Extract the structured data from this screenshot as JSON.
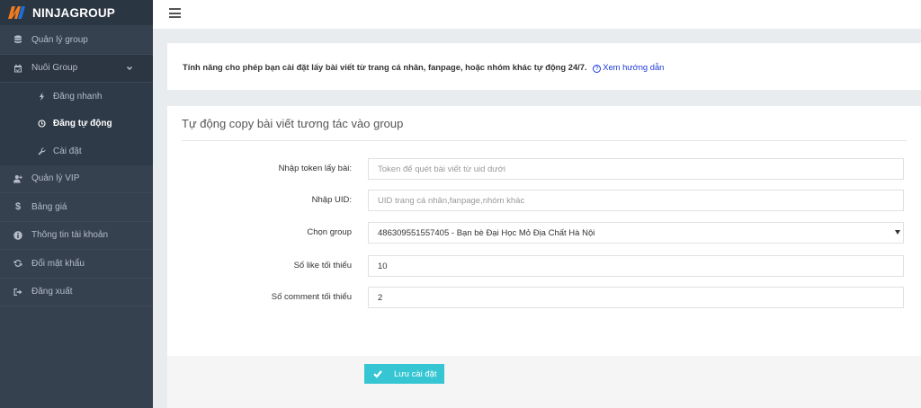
{
  "brand": {
    "name": "NINJAGROUP",
    "accent": "#f07b1f"
  },
  "topbar": {
    "menu_icon": "hamburger-icon"
  },
  "sidebar": {
    "items": [
      {
        "label": "Quản lý group",
        "icon": "database-icon"
      },
      {
        "label": "Nuôi Group",
        "icon": "calendar-check-icon",
        "expanded": true,
        "children": [
          {
            "label": "Đăng nhanh",
            "icon": "bolt-icon"
          },
          {
            "label": "Đăng tự động",
            "icon": "clock-icon",
            "active": true
          },
          {
            "label": "Cài đặt",
            "icon": "wrench-icon"
          }
        ]
      },
      {
        "label": "Quản lý VIP",
        "icon": "user-plus-icon"
      },
      {
        "label": "Bảng giá",
        "icon": "dollar-icon"
      },
      {
        "label": "Thông tin tài khoản",
        "icon": "info-circle-icon"
      },
      {
        "label": "Đổi mật khẩu",
        "icon": "refresh-icon"
      },
      {
        "label": "Đăng xuất",
        "icon": "sign-out-icon"
      }
    ],
    "colors": {
      "background": "#364150",
      "active_text": "#ffffff",
      "text": "#b4bcc8"
    }
  },
  "notice": {
    "text": "Tính năng cho phép bạn cài đặt lấy bài viết từ trang cá nhân, fanpage, hoặc nhóm khác tự động 24/7.",
    "link_label": "Xem hướng dẫn",
    "link_icon": "question-circle-icon",
    "link_color": "#1e3ad7"
  },
  "form": {
    "title": "Tự động copy bài viết tương tác vào group",
    "fields": {
      "token": {
        "label": "Nhập token lấy bài:",
        "value": "",
        "placeholder": "Token để quét bài viết từ uid dưới"
      },
      "uid": {
        "label": "Nhập UID:",
        "value": "",
        "placeholder": "UID trang cá nhân,fanpage,nhóm khác"
      },
      "group": {
        "label": "Chọn group",
        "selected": "486309551557405 - Bạn bè Đại Học Mỏ Địa Chất Hà Nội"
      },
      "min_like": {
        "label": "Số like tối thiểu",
        "value": "10"
      },
      "min_comment": {
        "label": "Số comment tối thiểu",
        "value": "2"
      }
    },
    "save_label": "Lưu cài đặt",
    "save_color": "#36c6d3"
  }
}
